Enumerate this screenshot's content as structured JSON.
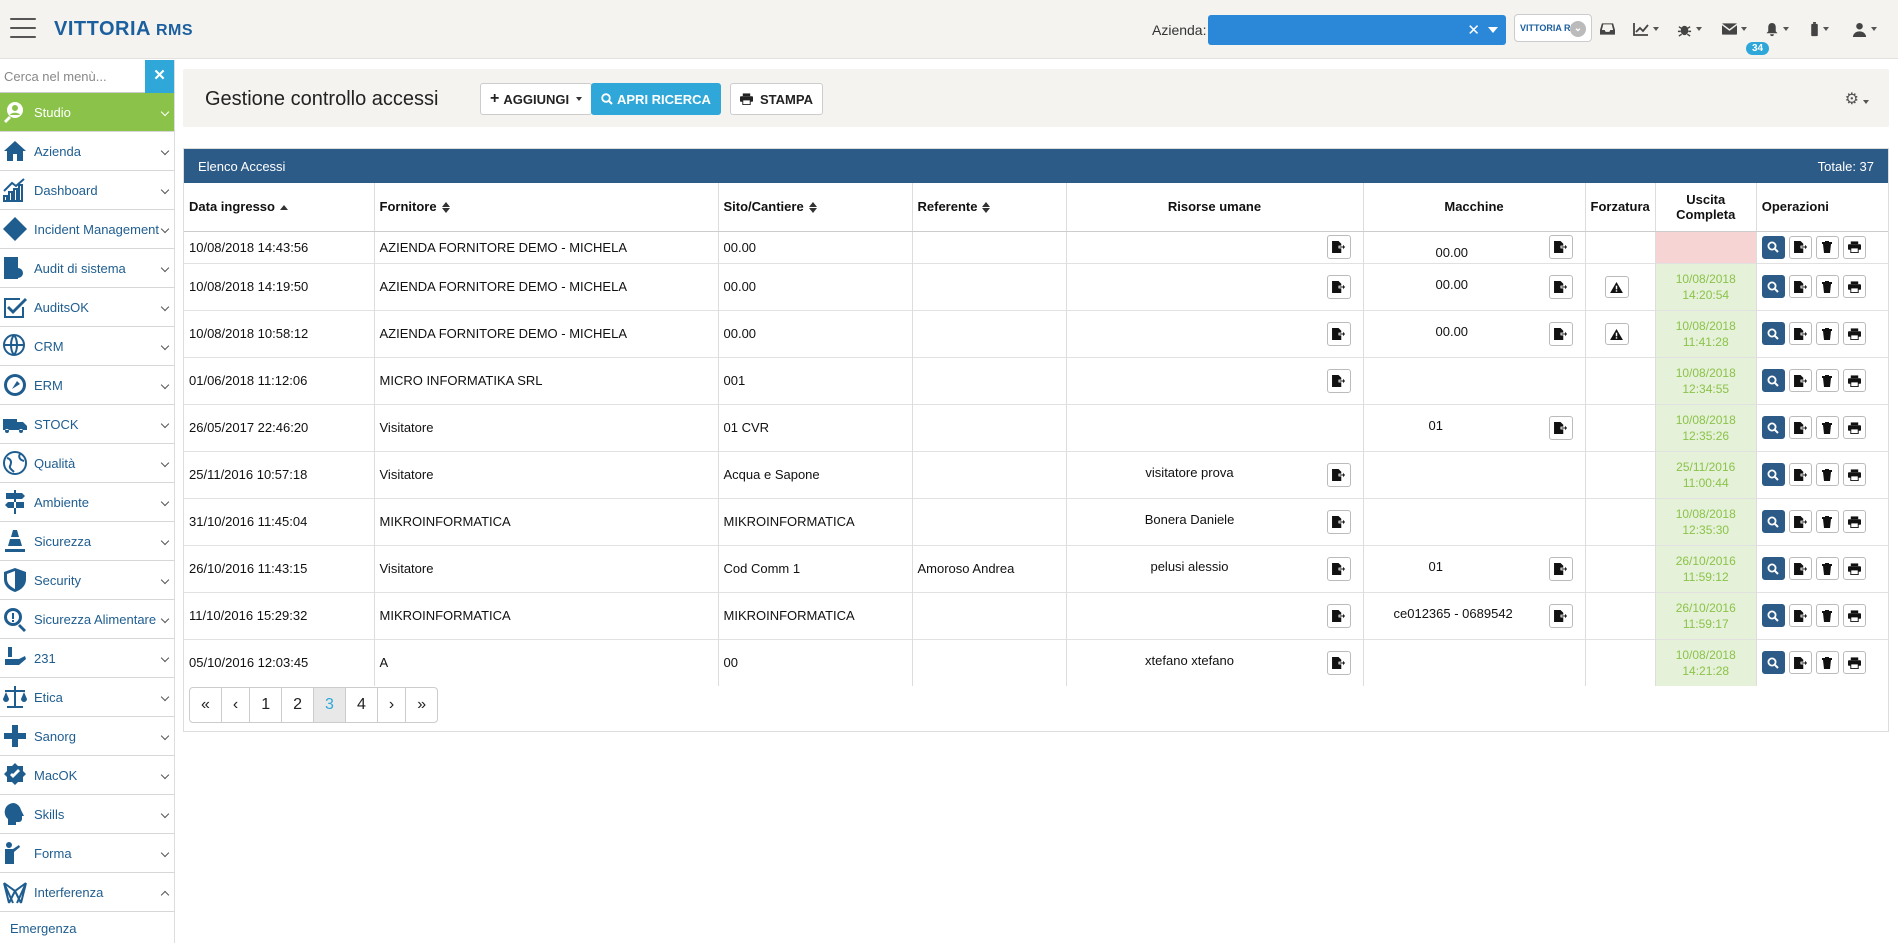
{
  "app": {
    "logo_main": "VITTORIA",
    "logo_sub": "RMS"
  },
  "topbar": {
    "azienda_label": "Azienda:",
    "azienda_value": "",
    "azienda_clear": "✕",
    "azienda_badge": "VITTORIA RMS",
    "notifications_count": "34"
  },
  "sidebar": {
    "search_placeholder": "Cerca nel menù...",
    "search_clear": "✕",
    "items": [
      {
        "label": "Studio",
        "icon": "studio-icon",
        "active": true
      },
      {
        "label": "Azienda",
        "icon": "home-icon"
      },
      {
        "label": "Dashboard",
        "icon": "chart-icon"
      },
      {
        "label": "Incident Management",
        "icon": "alert-icon"
      },
      {
        "label": "Audit di sistema",
        "icon": "audit-icon"
      },
      {
        "label": "AuditsOK",
        "icon": "check-icon"
      },
      {
        "label": "CRM",
        "icon": "globe-person-icon"
      },
      {
        "label": "ERM",
        "icon": "compass-icon"
      },
      {
        "label": "STOCK",
        "icon": "truck-icon"
      },
      {
        "label": "Qualità",
        "icon": "globe-icon"
      },
      {
        "label": "Ambiente",
        "icon": "signpost-icon"
      },
      {
        "label": "Sicurezza",
        "icon": "cone-icon"
      },
      {
        "label": "Security",
        "icon": "shield-icon"
      },
      {
        "label": "Sicurezza Alimentare",
        "icon": "food-search-icon"
      },
      {
        "label": "231",
        "icon": "hand-icon"
      },
      {
        "label": "Etica",
        "icon": "scale-icon"
      },
      {
        "label": "Sanorg",
        "icon": "cross-icon"
      },
      {
        "label": "MacOK",
        "icon": "badge-icon"
      },
      {
        "label": "Skills",
        "icon": "head-gear-icon"
      },
      {
        "label": "Forma",
        "icon": "teacher-icon"
      },
      {
        "label": "Interferenza",
        "icon": "network-icon",
        "expanded": true
      }
    ],
    "sub_items": [
      "Emergenza"
    ]
  },
  "header": {
    "title": "Gestione controllo accessi",
    "add_label": "AGGIUNGI",
    "search_label": "APRI RICERCA",
    "print_label": "STAMPA"
  },
  "panel": {
    "title": "Elenco Accessi",
    "total": "Totale: 37",
    "columns": [
      "Data ingresso",
      "Fornitore",
      "Sito/Cantiere",
      "Referente",
      "Risorse umane",
      "Macchine",
      "Forzatura",
      "Uscita Completa",
      "Operazioni"
    ],
    "rows": [
      {
        "data": "10/08/2018 14:43:56",
        "fornitore": "AZIENDA FORNITORE DEMO - MICHELA",
        "sito": "00.00",
        "referente": "",
        "risorse": "",
        "macchine": "00.00",
        "forzatura": false,
        "uscita": ""
      },
      {
        "data": "10/08/2018 14:19:50",
        "fornitore": "AZIENDA FORNITORE DEMO - MICHELA",
        "sito": "00.00",
        "referente": "",
        "risorse": "",
        "macchine": "00.00",
        "forzatura": true,
        "uscita": "10/08/2018 14:20:54"
      },
      {
        "data": "10/08/2018 10:58:12",
        "fornitore": "AZIENDA FORNITORE DEMO - MICHELA",
        "sito": "00.00",
        "referente": "",
        "risorse": "",
        "macchine": "00.00",
        "forzatura": true,
        "uscita": "10/08/2018 11:41:28"
      },
      {
        "data": "01/06/2018 11:12:06",
        "fornitore": "MICRO INFORMATIKA SRL",
        "sito": "001",
        "referente": "",
        "risorse": "",
        "macchine": null,
        "forzatura": false,
        "uscita": "10/08/2018 12:34:55"
      },
      {
        "data": "26/05/2017 22:46:20",
        "fornitore": "Visitatore",
        "sito": "01 CVR",
        "referente": "",
        "risorse": null,
        "macchine": "01",
        "forzatura": false,
        "uscita": "10/08/2018 12:35:26"
      },
      {
        "data": "25/11/2016 10:57:18",
        "fornitore": "Visitatore",
        "sito": "Acqua e Sapone",
        "referente": "",
        "risorse": "visitatore prova",
        "macchine": null,
        "forzatura": false,
        "uscita": "25/11/2016 11:00:44"
      },
      {
        "data": "31/10/2016 11:45:04",
        "fornitore": "MIKROINFORMATICA",
        "sito": "MIKROINFORMATICA",
        "referente": "",
        "risorse": "Bonera Daniele",
        "macchine": null,
        "forzatura": false,
        "uscita": "10/08/2018 12:35:30"
      },
      {
        "data": "26/10/2016 11:43:15",
        "fornitore": "Visitatore",
        "sito": "Cod Comm 1",
        "referente": "Amoroso Andrea",
        "risorse": "pelusi alessio",
        "macchine": "01",
        "forzatura": false,
        "uscita": "26/10/2016 11:59:12"
      },
      {
        "data": "11/10/2016 15:29:32",
        "fornitore": "MIKROINFORMATICA",
        "sito": "MIKROINFORMATICA",
        "referente": "",
        "risorse": "",
        "macchine": "ce012365 - 0689542",
        "forzatura": false,
        "uscita": "26/10/2016 11:59:17"
      },
      {
        "data": "05/10/2016 12:03:45",
        "fornitore": "A",
        "sito": "00",
        "referente": "",
        "risorse": "xtefano xtefano",
        "macchine": null,
        "forzatura": false,
        "uscita": "10/08/2018 14:21:28"
      }
    ]
  },
  "pagination": {
    "items": [
      "«",
      "‹",
      "1",
      "2",
      "3",
      "4",
      "›",
      "»"
    ],
    "current": "3"
  },
  "colors": {
    "primary": "#2d5b87",
    "accent": "#2fa8d9",
    "green": "#8bc34a"
  }
}
